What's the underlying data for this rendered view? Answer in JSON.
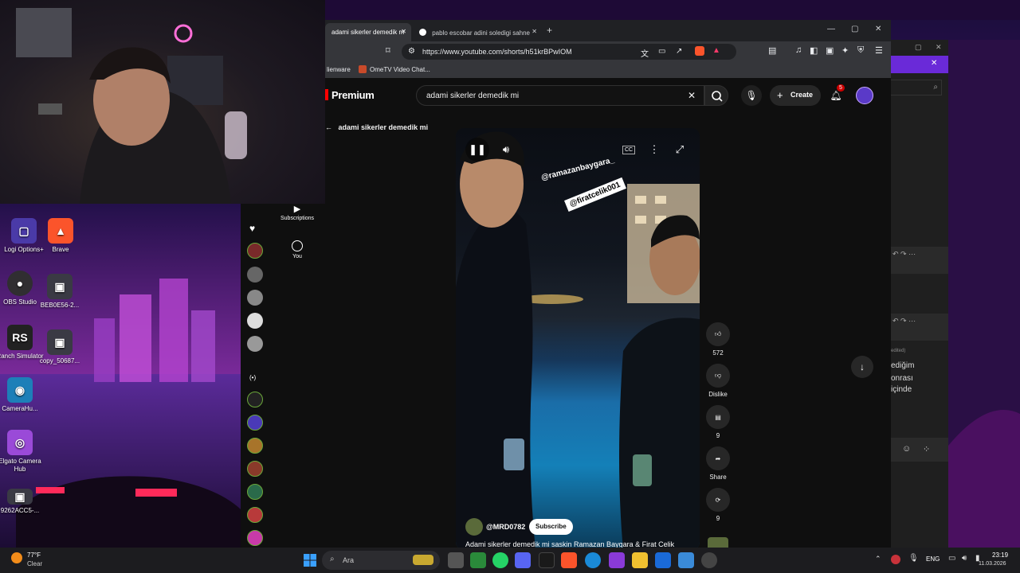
{
  "desktop": {
    "icons": [
      {
        "label": "Logi Options+"
      },
      {
        "label": "Brave"
      },
      {
        "label": "OBS Studio"
      },
      {
        "label": "BEB0E56-2..."
      },
      {
        "label": "Ranch Simulator"
      },
      {
        "label": "copy_50687..."
      },
      {
        "label": "CameraHu..."
      },
      {
        "label": "Elgato Camera Hub"
      },
      {
        "label": "9262ACC5-..."
      }
    ]
  },
  "browser": {
    "tabs": [
      {
        "title": "adami sikerler demedik m"
      },
      {
        "title": "pablo escobar adini soledigi sahne"
      }
    ],
    "new_tab": "+",
    "url": "https://www.youtube.com/shorts/h51krBPwIOM",
    "bookmarks": [
      {
        "label": "lienware"
      },
      {
        "label": "OmeTV Video Chat..."
      }
    ]
  },
  "youtube": {
    "logo_text": "Premium",
    "search_query": "adami sikerler demedik mi",
    "create_label": "Create",
    "notification_count": "5",
    "back_title": "adami sikerler demedik mi",
    "nav": [
      {
        "label": "Subscriptions"
      },
      {
        "label": "You"
      }
    ],
    "live_label": "(•)",
    "video": {
      "overlay_text_1": "@ramazanbaygara_",
      "overlay_text_2": "@firatcelik001",
      "channel": "@MRD0782",
      "subscribe_label": "Subscribe",
      "title": "Adami sikerler demedik mi saskin Ramazan Baygara & Firat Celik"
    },
    "actions": {
      "likes": "572",
      "dislike_label": "Dislike",
      "comments": "9",
      "share_label": "Share",
      "remix": "9"
    },
    "right_panel": {
      "text_lines": [
        "edited)",
        "ediğim",
        "onrası",
        "içinde"
      ]
    }
  },
  "taskbar": {
    "weather_temp": "77°F",
    "weather_desc": "Clear",
    "search_placeholder": "Ara",
    "language": "ENG",
    "time": "23:19",
    "date": "11.03.2026"
  }
}
